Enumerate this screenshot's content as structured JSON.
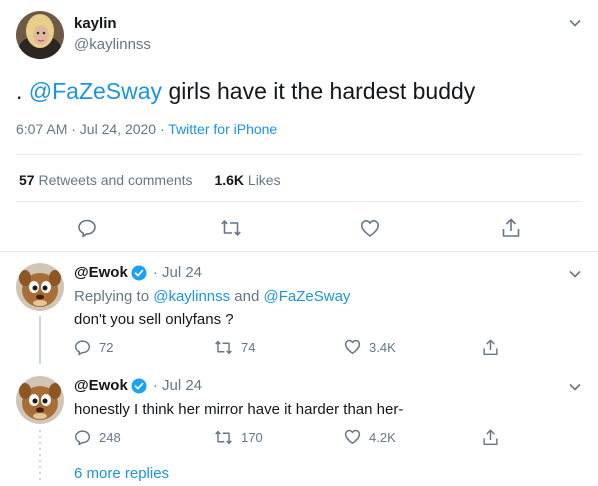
{
  "main_tweet": {
    "display_name": "kaylin",
    "handle": "@kaylinnss",
    "text_prefix": ". ",
    "mention": "@FaZeSway",
    "text_rest": " girls have it the hardest buddy",
    "time": "6:07 AM · Jul 24, 2020 · ",
    "source": "Twitter for iPhone",
    "retweets_count": "57",
    "retweets_label": "Retweets and comments",
    "likes_count": "1.6K",
    "likes_label": "Likes"
  },
  "replies": [
    {
      "display_name": "@Ewok",
      "date": "· Jul 24",
      "replying_prefix": "Replying to ",
      "replying_to_1": "@kaylinnss",
      "replying_and": " and ",
      "replying_to_2": "@FaZeSway",
      "text": "don't you sell onlyfans ?",
      "reply_count": "72",
      "retweet_count": "74",
      "like_count": "3.4K"
    },
    {
      "display_name": "@Ewok",
      "date": "· Jul 24",
      "text": "honestly I think her mirror have it harder than her-",
      "reply_count": "248",
      "retweet_count": "170",
      "like_count": "4.2K"
    }
  ],
  "more_replies": "6 more replies",
  "colors": {
    "accent": "#1b95e0",
    "verified": "#1da1f2",
    "muted": "#657786",
    "divider": "#e6ecf0"
  }
}
